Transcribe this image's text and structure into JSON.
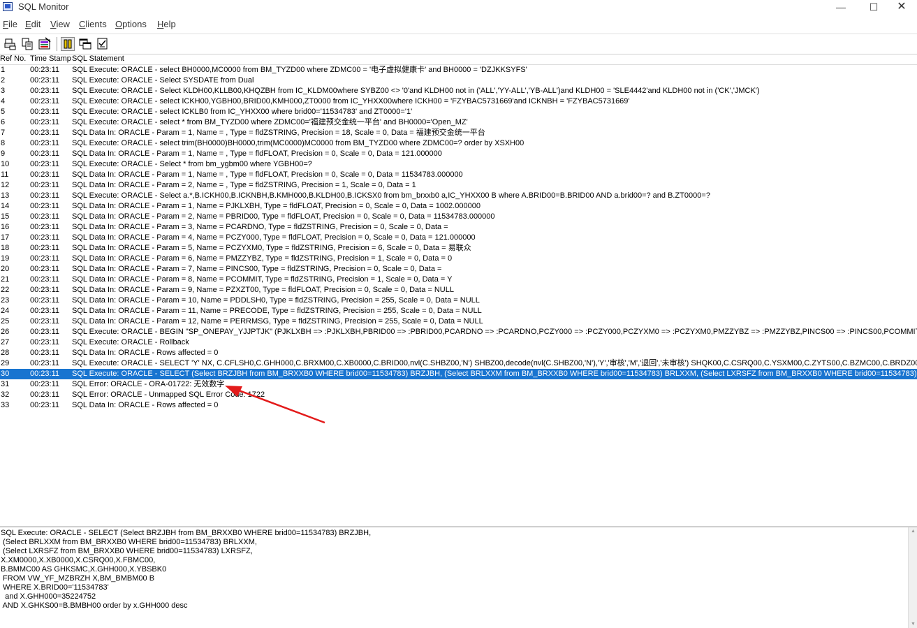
{
  "window": {
    "title": "SQL Monitor",
    "minimize": "—",
    "maximize": "☐",
    "close": "✕"
  },
  "menu": [
    "File",
    "Edit",
    "View",
    "Clients",
    "Options",
    "Help"
  ],
  "toolbar": {
    "icons": [
      "print-icon",
      "copy-icon",
      "clear-icon",
      "pause-icon",
      "windows-icon",
      "checklist-icon"
    ]
  },
  "list": {
    "headers": {
      "ref": "Ref No.",
      "time": "Time Stamp",
      "stmt": "SQL Statement"
    },
    "rows": [
      {
        "ref": "1",
        "time": "00:23:11",
        "stmt": "SQL Execute: ORACLE - select BH0000,MC0000 from BM_TYZD00 where ZDMC00 = '电子虚拟健康卡' and BH0000 = 'DZJKKSYFS'"
      },
      {
        "ref": "2",
        "time": "00:23:11",
        "stmt": "SQL Execute: ORACLE - Select SYSDATE from Dual"
      },
      {
        "ref": "3",
        "time": "00:23:11",
        "stmt": "SQL Execute: ORACLE - Select KLDH00,KLLB00,KHQZBH from IC_KLDM00where SYBZ00 <> '0'and KLDH00 not in ('ALL','YY-ALL','YB-ALL')and KLDH00 = 'SLE4442'and KLDH00 not in ('CK','JMCK')"
      },
      {
        "ref": "4",
        "time": "00:23:11",
        "stmt": "SQL Execute: ORACLE - select ICKH00,YGBH00,BRID00,KMH000,ZT0000 from IC_YHXX00where ICKH00 = 'FZYBAC5731669'and ICKNBH = 'FZYBAC5731669'"
      },
      {
        "ref": "5",
        "time": "00:23:11",
        "stmt": "SQL Execute: ORACLE -  select ICKLB0 from IC_YHXX00 where brid00='11534783' and ZT0000='1'"
      },
      {
        "ref": "6",
        "time": "00:23:11",
        "stmt": "SQL Execute: ORACLE - select *  from BM_TYZD00 where ZDMC00='福建预交金统一平台' and BH0000='Open_MZ'"
      },
      {
        "ref": "7",
        "time": "00:23:11",
        "stmt": "SQL Data In: ORACLE - Param = 1, Name = , Type = fldZSTRING, Precision = 18, Scale = 0, Data = 福建预交金统一平台"
      },
      {
        "ref": "8",
        "time": "00:23:11",
        "stmt": "SQL Execute: ORACLE - select trim(BH0000)BH0000,trim(MC0000)MC0000 from BM_TYZD00 where ZDMC00=? order by XSXH00"
      },
      {
        "ref": "9",
        "time": "00:23:11",
        "stmt": "SQL Data In: ORACLE - Param = 1, Name = , Type = fldFLOAT, Precision = 0, Scale = 0, Data = 121.000000"
      },
      {
        "ref": "10",
        "time": "00:23:11",
        "stmt": "SQL Execute: ORACLE - Select *  from bm_ygbm00 where YGBH00=?"
      },
      {
        "ref": "11",
        "time": "00:23:11",
        "stmt": "SQL Data In: ORACLE - Param = 1, Name = , Type = fldFLOAT, Precision = 0, Scale = 0, Data = 11534783.000000"
      },
      {
        "ref": "12",
        "time": "00:23:11",
        "stmt": "SQL Data In: ORACLE - Param = 2, Name = , Type = fldZSTRING, Precision = 1, Scale = 0, Data = 1"
      },
      {
        "ref": "13",
        "time": "00:23:11",
        "stmt": "SQL Execute: ORACLE - Select a.*,B.ICKH00,B.ICKNBH,B.KMH000,B.KLDH00,B.ICKSX0  from bm_brxxb0 a,IC_YHXX00 B where A.BRID00=B.BRID00 AND a.brid00=? and B.ZT0000=?"
      },
      {
        "ref": "14",
        "time": "00:23:11",
        "stmt": "SQL Data In: ORACLE - Param = 1, Name = PJKLXBH, Type = fldFLOAT, Precision = 0, Scale = 0, Data = 1002.000000"
      },
      {
        "ref": "15",
        "time": "00:23:11",
        "stmt": "SQL Data In: ORACLE - Param = 2, Name = PBRID00, Type = fldFLOAT, Precision = 0, Scale = 0, Data = 11534783.000000"
      },
      {
        "ref": "16",
        "time": "00:23:11",
        "stmt": "SQL Data In: ORACLE - Param = 3, Name = PCARDNO, Type = fldZSTRING, Precision = 0, Scale = 0, Data ="
      },
      {
        "ref": "17",
        "time": "00:23:11",
        "stmt": "SQL Data In: ORACLE - Param = 4, Name = PCZY000, Type = fldFLOAT, Precision = 0, Scale = 0, Data = 121.000000"
      },
      {
        "ref": "18",
        "time": "00:23:11",
        "stmt": "SQL Data In: ORACLE - Param = 5, Name = PCZYXM0, Type = fldZSTRING, Precision = 6, Scale = 0, Data = 易联众"
      },
      {
        "ref": "19",
        "time": "00:23:11",
        "stmt": "SQL Data In: ORACLE - Param = 6, Name = PMZZYBZ, Type = fldZSTRING, Precision = 1, Scale = 0, Data = 0"
      },
      {
        "ref": "20",
        "time": "00:23:11",
        "stmt": "SQL Data In: ORACLE - Param = 7, Name = PINCS00, Type = fldZSTRING, Precision = 0, Scale = 0, Data ="
      },
      {
        "ref": "21",
        "time": "00:23:11",
        "stmt": "SQL Data In: ORACLE - Param = 8, Name = PCOMMIT, Type = fldZSTRING, Precision = 1, Scale = 0, Data = Y"
      },
      {
        "ref": "22",
        "time": "00:23:11",
        "stmt": "SQL Data In: ORACLE - Param = 9, Name = PZXZT00, Type = fldFLOAT, Precision = 0, Scale = 0, Data = NULL"
      },
      {
        "ref": "23",
        "time": "00:23:11",
        "stmt": "SQL Data In: ORACLE - Param = 10, Name = PDDLSH0, Type = fldZSTRING, Precision = 255, Scale = 0, Data = NULL"
      },
      {
        "ref": "24",
        "time": "00:23:11",
        "stmt": "SQL Data In: ORACLE - Param = 11, Name = PRECODE, Type = fldZSTRING, Precision = 255, Scale = 0, Data = NULL"
      },
      {
        "ref": "25",
        "time": "00:23:11",
        "stmt": "SQL Data In: ORACLE - Param = 12, Name = PERRMSG, Type = fldZSTRING, Precision = 255, Scale = 0, Data = NULL"
      },
      {
        "ref": "26",
        "time": "00:23:11",
        "stmt": "SQL Execute: ORACLE - BEGIN \"SP_ONEPAY_YJJPTJK\" (PJKLXBH => :PJKLXBH,PBRID00 => :PBRID00,PCARDNO => :PCARDNO,PCZY000 => :PCZY000,PCZYXM0 => :PCZYXM0,PMZZYBZ => :PMZZYBZ,PINCS00 => :PINCS00,PCOMMIT => :PCO"
      },
      {
        "ref": "27",
        "time": "00:23:11",
        "stmt": "SQL Execute: ORACLE - Rollback"
      },
      {
        "ref": "28",
        "time": "00:23:11",
        "stmt": "SQL Data In: ORACLE - Rows affected = 0"
      },
      {
        "ref": "29",
        "time": "00:23:11",
        "stmt": "SQL Execute: ORACLE - SELECT 'Y' NX, C.CFLSH0,C.GHH000,C.BRXM00,C.XB0000,C.BRID00,nvl(C.SHBZ00,'N') SHBZ00,decode(nvl(C.SHBZ00,'N'),'Y','审核','M','退回','未审核') SHQK00,C.CSRQ00,C.YSXM00,C.ZYTS00,C.BZMC00,C.BRDZ00,C.SRI"
      },
      {
        "ref": "30",
        "time": "00:23:11",
        "stmt": "SQL Execute: ORACLE - SELECT (Select BRZJBH from BM_BRXXB0 WHERE brid00=11534783) BRZJBH, (Select BRLXXM from BM_BRXXB0 WHERE brid00=11534783) BRLXXM,  (Select LXRSFZ from BM_BRXXB0 WHERE brid00=11534783) LXRSF",
        "selected": true
      },
      {
        "ref": "31",
        "time": "00:23:11",
        "stmt": "SQL Error: ORACLE - ORA-01722: 无效数字"
      },
      {
        "ref": "32",
        "time": "00:23:11",
        "stmt": "SQL Error: ORACLE - Unmapped SQL Error Code: 1722"
      },
      {
        "ref": "33",
        "time": "00:23:11",
        "stmt": "SQL Data In: ORACLE - Rows affected = 0"
      }
    ]
  },
  "detail": {
    "lines": [
      "SQL Execute: ORACLE - SELECT (Select BRZJBH from BM_BRXXB0 WHERE brid00=11534783) BRZJBH,",
      " (Select BRLXXM from BM_BRXXB0 WHERE brid00=11534783) BRLXXM,",
      " (Select LXRSFZ from BM_BRXXB0 WHERE brid00=11534783) LXRSFZ,",
      "X.XM0000,X.XB0000,X.CSRQ00,X.FBMC00,",
      "B.BMMC00 AS GHKSMC,X.GHH000,X.YBSBK0",
      " FROM VW_YF_MZBRZH X,BM_BMBM00 B",
      " WHERE X.BRID00='11534783'",
      "  and X.GHH000=35224752",
      " AND X.GHKS00=B.BMBH00 order by x.GHH000 desc"
    ]
  },
  "colors": {
    "selection": "#1874d0",
    "annotation_arrow": "#e31b1b"
  }
}
